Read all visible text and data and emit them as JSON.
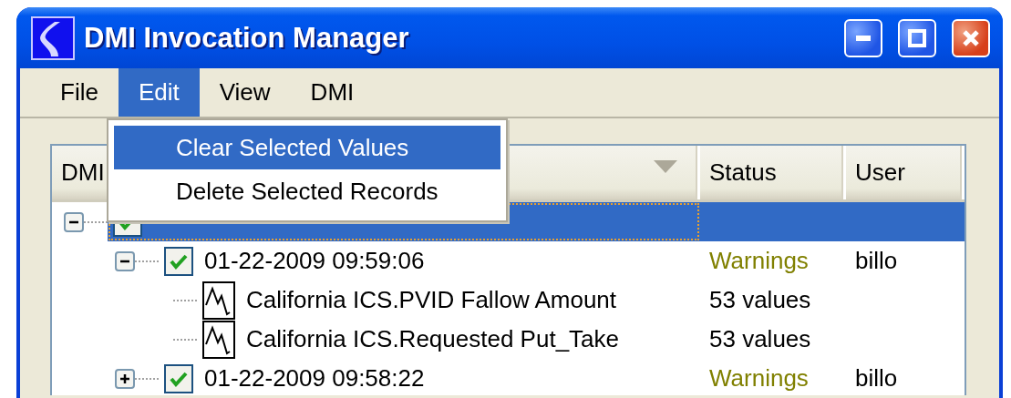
{
  "window": {
    "title": "DMI Invocation Manager"
  },
  "menu_bar": [
    {
      "label": "File",
      "selected": false
    },
    {
      "label": "Edit",
      "selected": true
    },
    {
      "label": "View",
      "selected": false
    },
    {
      "label": "DMI",
      "selected": false
    }
  ],
  "edit_menu": [
    {
      "label": "Clear Selected Values",
      "selected": true
    },
    {
      "label": "Delete Selected Records",
      "selected": false
    }
  ],
  "tree": {
    "columns": [
      "DMI",
      "Status",
      "User"
    ],
    "rows": [
      {
        "kind": "group",
        "selected": true,
        "checked": true,
        "expanded": true,
        "children": [
          {
            "kind": "run",
            "label": "01-22-2009 09:59:06",
            "status": "Warnings",
            "user": "billo",
            "selected": false,
            "checked": true,
            "expanded": true,
            "children": [
              {
                "kind": "series",
                "label": "California ICS.PVID Fallow Amount",
                "status": "53 values",
                "selected": false
              },
              {
                "kind": "series",
                "label": "California ICS.Requested Put_Take",
                "status": "53 values",
                "selected": false
              }
            ]
          },
          {
            "kind": "run",
            "label": "01-22-2009 09:58:22",
            "status": "Warnings",
            "user": "billo",
            "selected": false,
            "checked": true,
            "expanded": false
          }
        ]
      }
    ]
  }
}
